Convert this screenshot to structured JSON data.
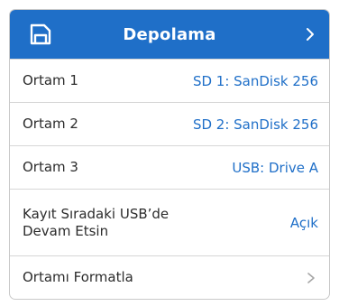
{
  "header": {
    "title": "Depolama",
    "icon": "storage-icon",
    "chevron": "chevron-right-icon",
    "accent_color": "#1f6fc8"
  },
  "rows": [
    {
      "label": "Ortam 1",
      "value": "SD 1: SanDisk 256"
    },
    {
      "label": "Ortam 2",
      "value": "SD 2: SanDisk 256"
    },
    {
      "label": "Ortam 3",
      "value": "USB: Drive A"
    },
    {
      "label": "Kayıt Sıradaki USB’de Devam Etsin",
      "value": "Açık"
    },
    {
      "label": "Ortamı Formatla",
      "icon": "chevron-right-icon"
    }
  ]
}
